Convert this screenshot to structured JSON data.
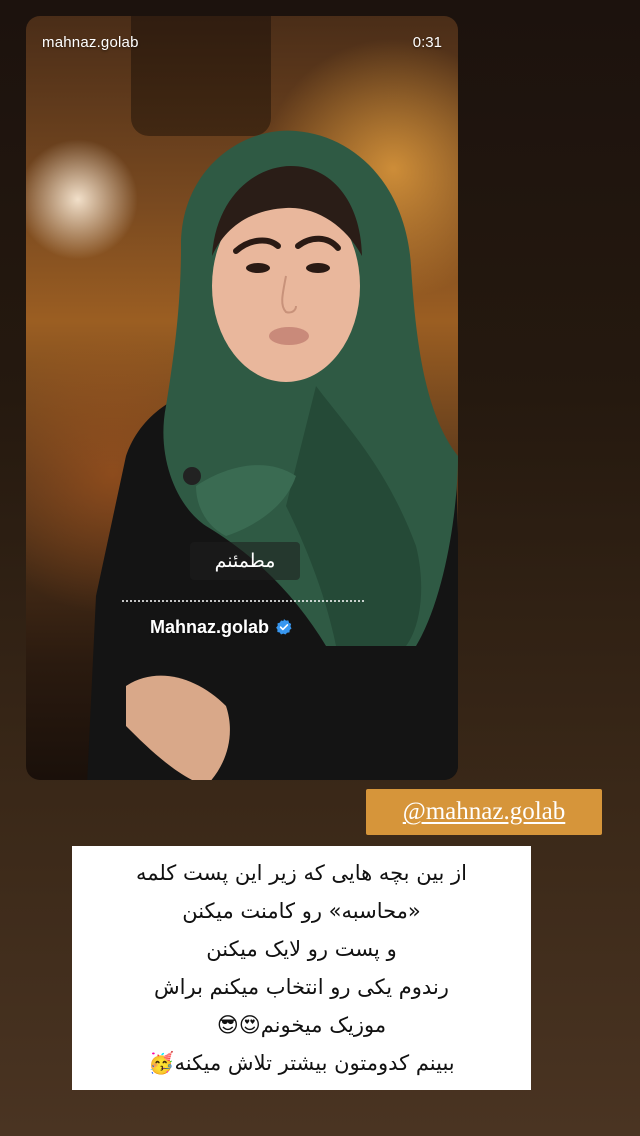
{
  "story": {
    "username": "mahnaz.golab",
    "time": "0:31",
    "caption_overlay": "مطمئنم",
    "watermark_text": "Mahnaz.golab",
    "verified_badge_color": "#3897f0"
  },
  "mention_sticker": {
    "text": "@mahnaz.golab",
    "background": "#d6953a"
  },
  "text_box": {
    "lines": [
      "از بین بچه هایی که زیر این پست کلمه",
      "«محاسبه» رو کامنت میکنن",
      "و پست رو لایک میکنن",
      "رندوم یکی رو انتخاب میکنم براش",
      "موزیک میخونم😍😎",
      "ببینم کدومتون بیشتر تلاش میکنه🥳"
    ]
  }
}
